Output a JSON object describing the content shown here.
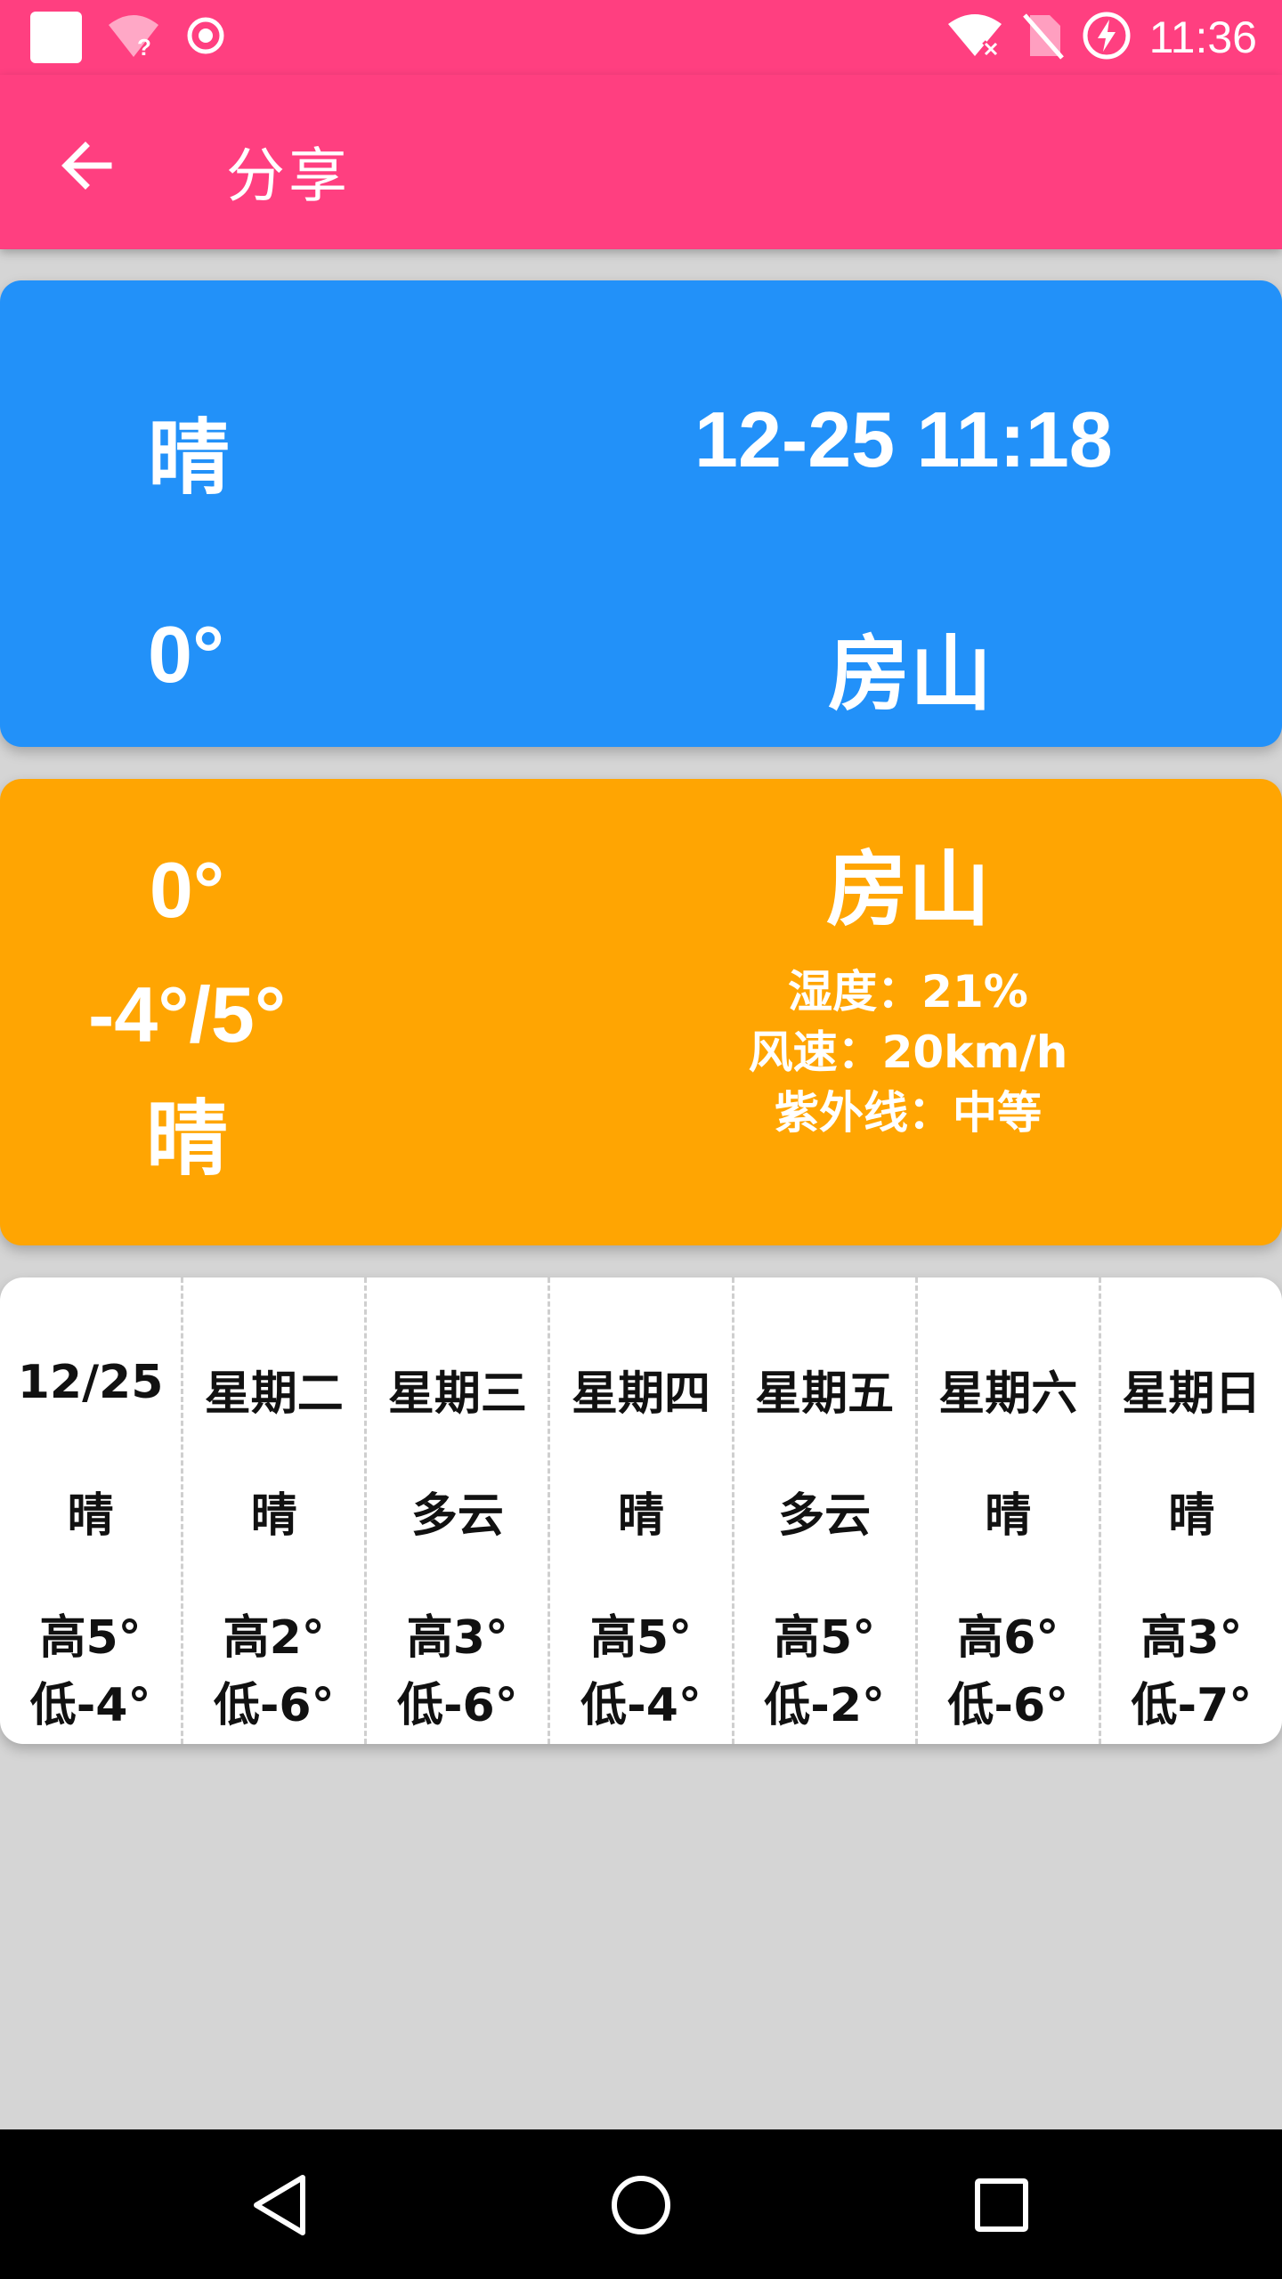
{
  "status_bar": {
    "time": "11:36",
    "icons": [
      "notification-square-icon",
      "wifi-unknown-icon",
      "record-icon",
      "wifi-off-icon",
      "no-sim-icon",
      "battery-charging-icon"
    ]
  },
  "app_bar": {
    "title": "分享",
    "back_icon": "arrow-left-icon"
  },
  "current_card": {
    "weather": "晴",
    "datetime": "12-25 11:18",
    "temperature": "0°",
    "city": "房山",
    "color": "#2291f9"
  },
  "detail_card": {
    "temperature": "0°",
    "range": "-4°/5°",
    "weather": "晴",
    "city": "房山",
    "humidity": "湿度：21%",
    "wind": "风速：20km/h",
    "uv": "紫外线：中等",
    "color": "#ffa502"
  },
  "forecast": [
    {
      "day": "12/25",
      "weather": "晴",
      "high": "高5°",
      "low": "低-4°"
    },
    {
      "day": "星期二",
      "weather": "晴",
      "high": "高2°",
      "low": "低-6°"
    },
    {
      "day": "星期三",
      "weather": "多云",
      "high": "高3°",
      "low": "低-6°"
    },
    {
      "day": "星期四",
      "weather": "晴",
      "high": "高5°",
      "low": "低-4°"
    },
    {
      "day": "星期五",
      "weather": "多云",
      "high": "高5°",
      "low": "低-2°"
    },
    {
      "day": "星期六",
      "weather": "晴",
      "high": "高6°",
      "low": "低-6°"
    },
    {
      "day": "星期日",
      "weather": "晴",
      "high": "高3°",
      "low": "低-7°"
    }
  ],
  "nav_bar": {
    "back": "nav-back-icon",
    "home": "nav-home-icon",
    "recents": "nav-recents-icon"
  },
  "theme": {
    "primary": "#ff3f80",
    "background": "#d5d5d5"
  }
}
